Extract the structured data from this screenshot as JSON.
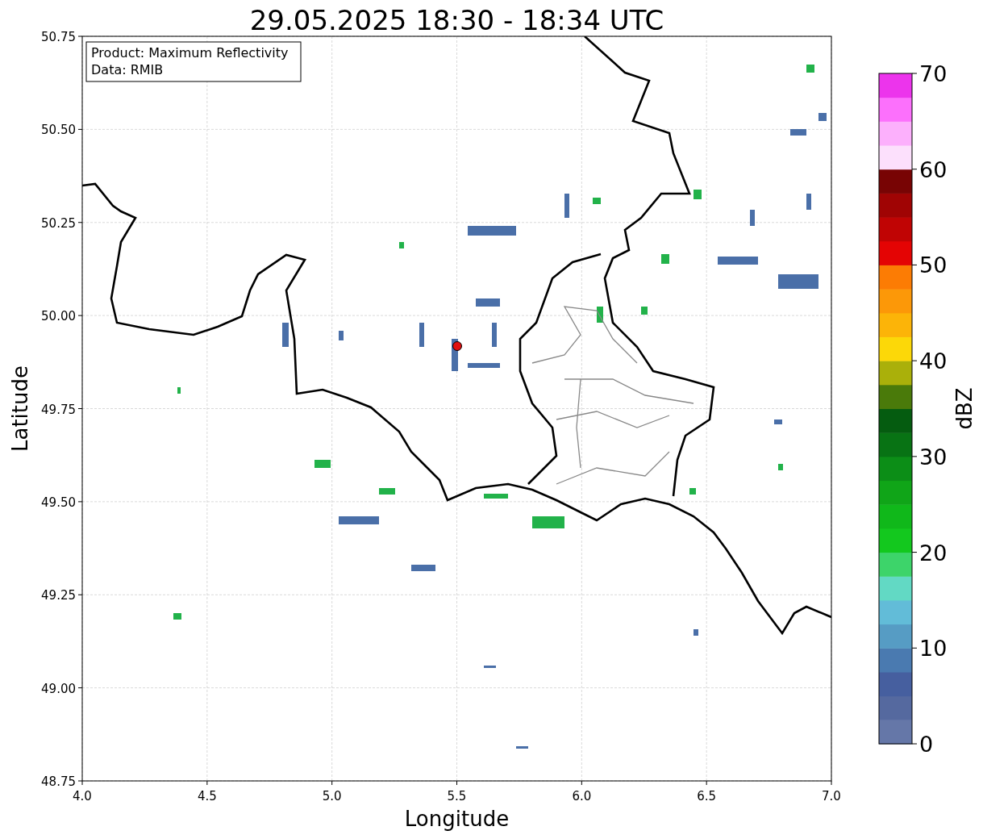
{
  "title": "29.05.2025 18:30 - 18:34 UTC",
  "legend": [
    "Product: Maximum Reflectivity",
    "Data: RMIB"
  ],
  "x_axis": {
    "label": "Longitude",
    "ticks": [
      "4.0",
      "4.5",
      "5.0",
      "5.5",
      "6.0",
      "6.5",
      "7.0"
    ]
  },
  "y_axis": {
    "label": "Latitude",
    "ticks": [
      "50.75",
      "50.50",
      "50.25",
      "50.00",
      "49.75",
      "49.50",
      "49.25",
      "49.00",
      "48.75"
    ]
  },
  "colorbar": {
    "label": "dBZ",
    "ticks": [
      "70",
      "60",
      "50",
      "40",
      "30",
      "20",
      "10",
      "0"
    ],
    "segments": [
      {
        "color": "#6577a8"
      },
      {
        "color": "#55699f"
      },
      {
        "color": "#465f9f"
      },
      {
        "color": "#4a7ab0"
      },
      {
        "color": "#569cc4"
      },
      {
        "color": "#62bcd8"
      },
      {
        "color": "#62d9c4"
      },
      {
        "color": "#3dd46a"
      },
      {
        "color": "#13c81e"
      },
      {
        "color": "#10b81a"
      },
      {
        "color": "#10a518"
      },
      {
        "color": "#0c8e17"
      },
      {
        "color": "#087314"
      },
      {
        "color": "#055c10"
      },
      {
        "color": "#4a7a0a"
      },
      {
        "color": "#aab00a"
      },
      {
        "color": "#fcd808"
      },
      {
        "color": "#fcb408"
      },
      {
        "color": "#fc9808"
      },
      {
        "color": "#fc7c04"
      },
      {
        "color": "#e40404"
      },
      {
        "color": "#c00404"
      },
      {
        "color": "#a00404"
      },
      {
        "color": "#780404"
      },
      {
        "color": "#fce0fc"
      },
      {
        "color": "#fcb0fc"
      },
      {
        "color": "#fc70fc"
      },
      {
        "color": "#ec34ec"
      }
    ]
  }
}
